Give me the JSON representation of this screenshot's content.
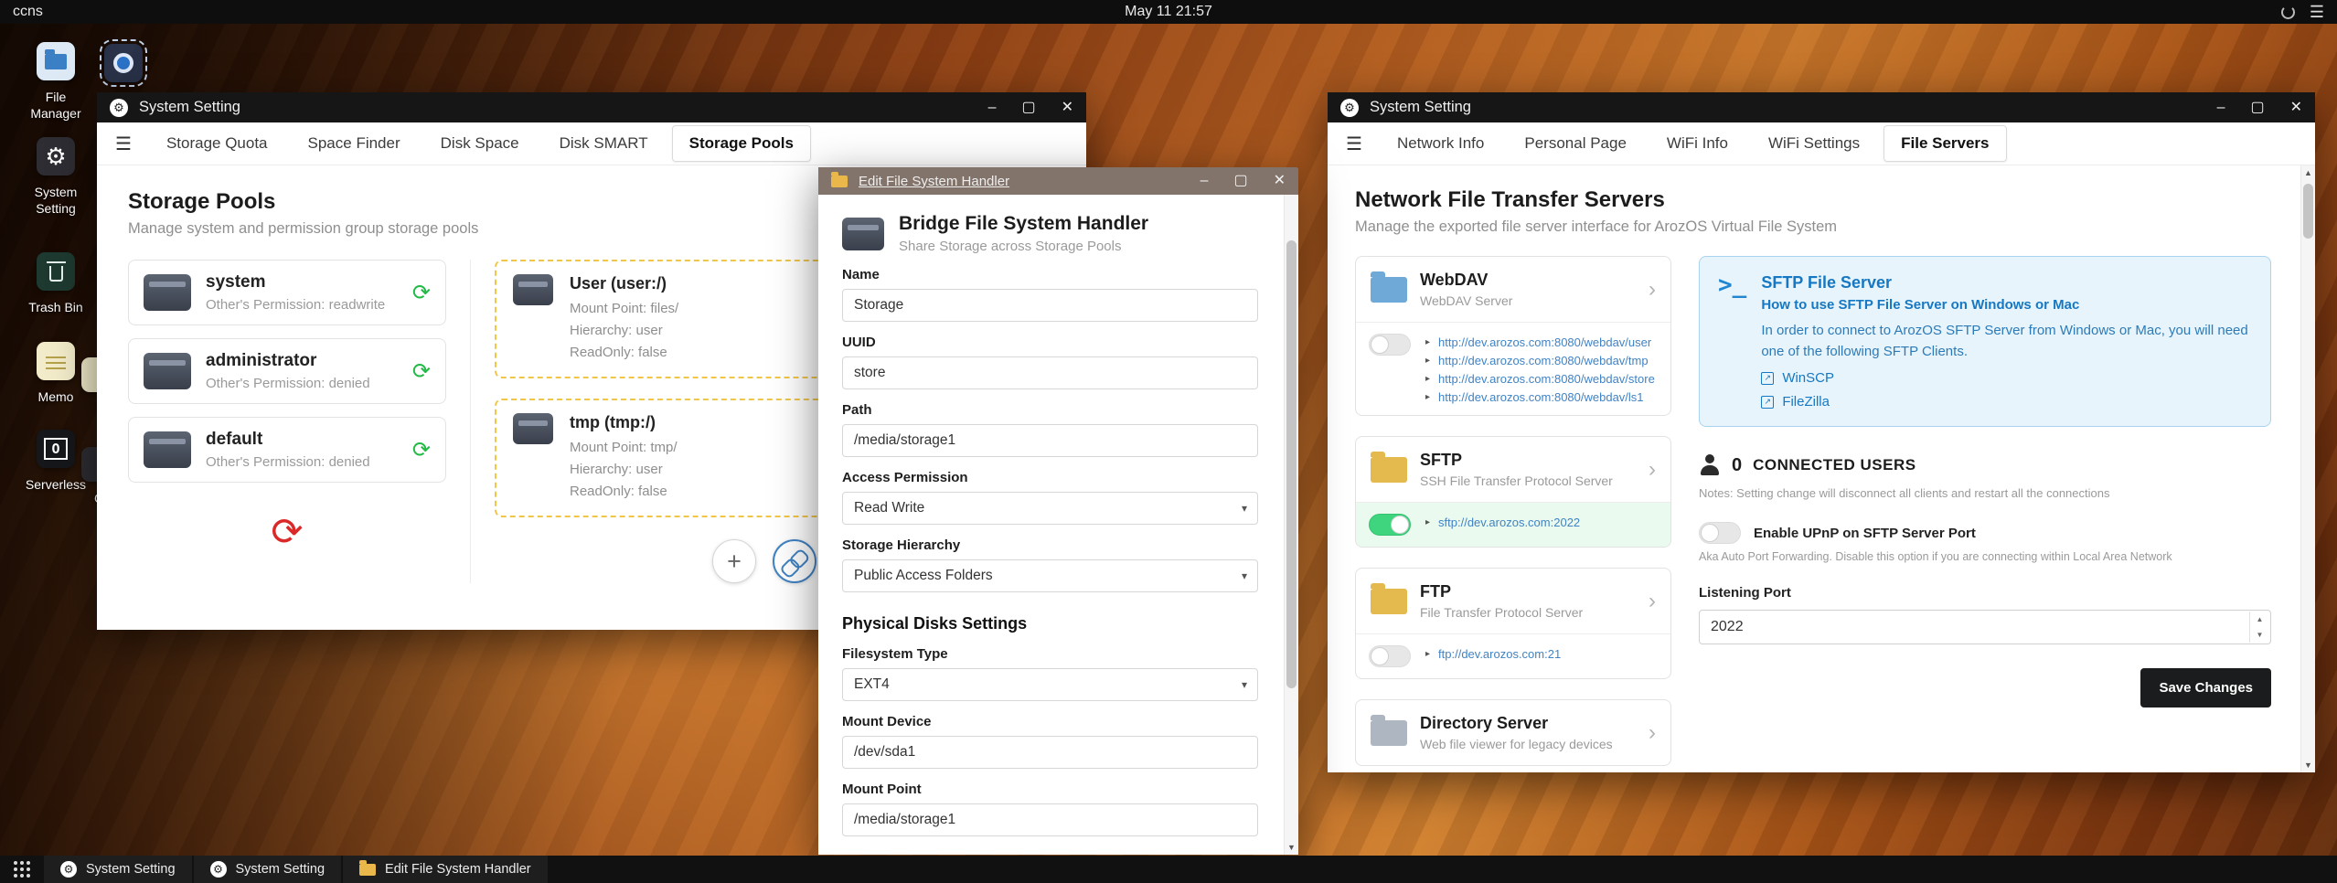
{
  "colors": {
    "accent_blue": "#4183c4",
    "toggle_green": "#3fd47e",
    "sync_green": "#21ba45",
    "refresh_red": "#db2828",
    "dashed_yellow": "#f0c64a",
    "info_blue_bg": "#e7f4fc",
    "save_dark": "#1b1c1d"
  },
  "topbar": {
    "menu": "ccns",
    "clock": "May 11 21:57"
  },
  "desktop": {
    "icons": [
      {
        "label": "File Manager"
      },
      {
        "label": "System Setting"
      },
      {
        "label": "Trash Bin"
      },
      {
        "label": "Memo"
      },
      {
        "label": "Serverless"
      }
    ],
    "partial_labels": [
      "I",
      "C"
    ]
  },
  "win_pools": {
    "title": "System Setting",
    "tabs": [
      "Storage Quota",
      "Space Finder",
      "Disk Space",
      "Disk SMART",
      "Storage Pools"
    ],
    "active_tab": "Storage Pools",
    "heading": "Storage Pools",
    "subheading": "Manage system and permission group storage pools",
    "pools": [
      {
        "name": "system",
        "permission": "Other's Permission: readwrite"
      },
      {
        "name": "administrator",
        "permission": "Other's Permission: denied"
      },
      {
        "name": "default",
        "permission": "Other's Permission: denied"
      }
    ],
    "mounts": [
      {
        "name": "User (user:/)",
        "mount_point": "Mount Point: files/",
        "hierarchy": "Hierarchy: user",
        "readonly": "ReadOnly: false"
      },
      {
        "name": "tmp (tmp:/)",
        "mount_point": "Mount Point: tmp/",
        "hierarchy": "Hierarchy: user",
        "readonly": "ReadOnly: false"
      }
    ]
  },
  "win_edit": {
    "title": "Edit File System Handler",
    "header_title": "Bridge File System Handler",
    "header_subtitle": "Share Storage across Storage Pools",
    "name_label": "Name",
    "name_value": "Storage",
    "uuid_label": "UUID",
    "uuid_value": "store",
    "path_label": "Path",
    "path_value": "/media/storage1",
    "access_label": "Access Permission",
    "access_value": "Read Write",
    "hierarchy_label": "Storage Hierarchy",
    "hierarchy_value": "Public Access Folders",
    "section": "Physical Disks Settings",
    "fstype_label": "Filesystem Type",
    "fstype_value": "EXT4",
    "mount_device_label": "Mount Device",
    "mount_device_value": "/dev/sda1",
    "mount_point_label": "Mount Point",
    "mount_point_value": "/media/storage1"
  },
  "win_net": {
    "title": "System Setting",
    "tabs": [
      "Network Info",
      "Personal Page",
      "WiFi Info",
      "WiFi Settings",
      "File Servers"
    ],
    "active_tab": "File Servers",
    "heading": "Network File Transfer Servers",
    "subheading": "Manage the exported file server interface for ArozOS Virtual File System",
    "servers": [
      {
        "name": "WebDAV",
        "desc": "WebDAV Server",
        "enabled": false,
        "links": [
          "http://dev.arozos.com:8080/webdav/user",
          "http://dev.arozos.com:8080/webdav/tmp",
          "http://dev.arozos.com:8080/webdav/store",
          "http://dev.arozos.com:8080/webdav/ls1"
        ]
      },
      {
        "name": "SFTP",
        "desc": "SSH File Transfer Protocol Server",
        "enabled": true,
        "links": [
          "sftp://dev.arozos.com:2022"
        ]
      },
      {
        "name": "FTP",
        "desc": "File Transfer Protocol Server",
        "enabled": false,
        "links": [
          "ftp://dev.arozos.com:21"
        ]
      },
      {
        "name": "Directory Server",
        "desc": "Web file viewer for legacy devices"
      }
    ],
    "info": {
      "title": "SFTP File Server",
      "subtitle": "How to use SFTP File Server on Windows or Mac",
      "body": "In order to connect to ArozOS SFTP Server from Windows or Mac, you will need one of the following SFTP Clients.",
      "clients": [
        "WinSCP",
        "FileZilla"
      ]
    },
    "connected_count": "0",
    "connected_label": "CONNECTED USERS",
    "connected_note": "Notes: Setting change will disconnect all clients and restart all the connections",
    "upnp_label": "Enable UPnP on SFTP Server Port",
    "upnp_note": "Aka Auto Port Forwarding. Disable this option if you are connecting within Local Area Network",
    "port_label": "Listening Port",
    "port_value": "2022",
    "save_label": "Save Changes"
  },
  "taskbar": {
    "items": [
      "System Setting",
      "System Setting",
      "Edit File System Handler"
    ]
  }
}
